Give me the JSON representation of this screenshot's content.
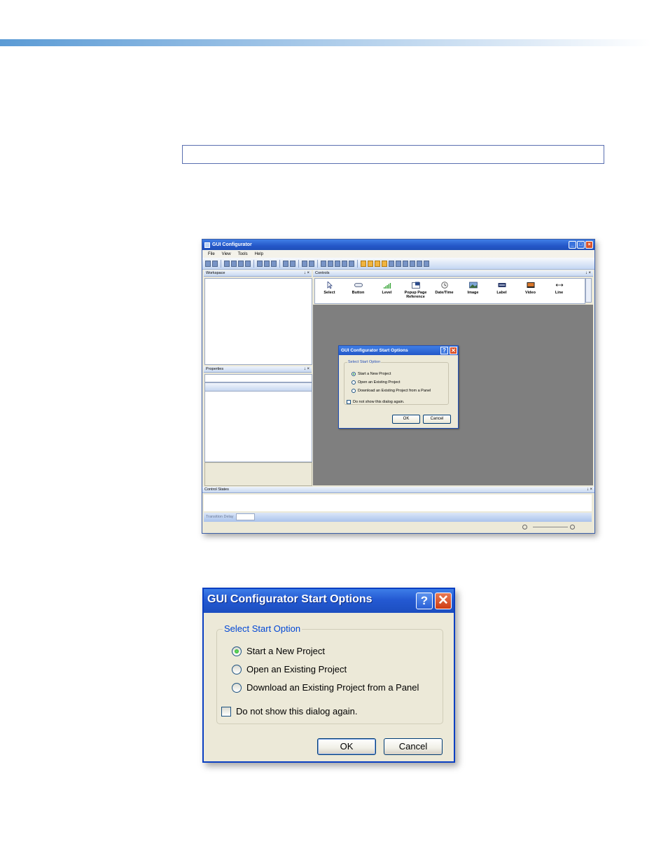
{
  "app": {
    "title": "GUI Configurator",
    "menu": [
      "File",
      "View",
      "Tools",
      "Help"
    ],
    "panels": {
      "workspace": "Workspace",
      "controls": "Controls",
      "properties": "Properties",
      "control_states": "Control States"
    },
    "panel_pin_close": "↓ ×",
    "controls": [
      {
        "label": "Select",
        "icon": "cursor-icon"
      },
      {
        "label": "Button",
        "icon": "button-icon"
      },
      {
        "label": "Level",
        "icon": "level-bars-icon"
      },
      {
        "label": "Popup Page Reference",
        "icon": "popup-page-icon"
      },
      {
        "label": "Date/Time",
        "icon": "clock-icon"
      },
      {
        "label": "Image",
        "icon": "image-icon"
      },
      {
        "label": "Label",
        "icon": "label-icon"
      },
      {
        "label": "Video",
        "icon": "video-icon"
      },
      {
        "label": "Line",
        "icon": "line-icon"
      }
    ],
    "transition_delay_label": "Transition Delay"
  },
  "dialog": {
    "title": "GUI Configurator Start Options",
    "group_label": "Select Start Option",
    "options": [
      {
        "label": "Start a New Project",
        "selected": true
      },
      {
        "label": "Open an Existing Project",
        "selected": false
      },
      {
        "label": "Download an Existing Project from a Panel",
        "selected": false
      }
    ],
    "checkbox_label": "Do not show this dialog again.",
    "checkbox_checked": false,
    "ok_label": "OK",
    "cancel_label": "Cancel",
    "help_glyph": "?",
    "close_glyph": "✕"
  }
}
